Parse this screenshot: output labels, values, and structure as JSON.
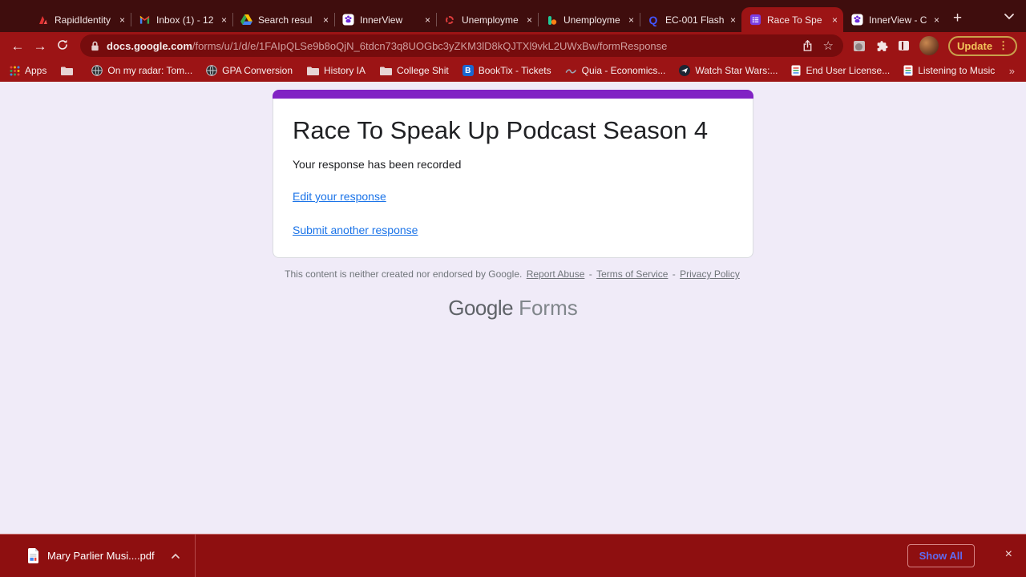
{
  "colors": {
    "tabstrip_bg": "#3f0d0d",
    "toolbar_bg": "#9c1415",
    "omnibox_bg": "#760c0d",
    "page_bg": "#f0ebf8",
    "form_purple": "#8123c4",
    "link_blue": "#1a73e8",
    "shelf_bg": "#8e0f10",
    "update_gold": "#f3c45a",
    "show_all_blue": "#5f6af0"
  },
  "browser": {
    "tabs": [
      {
        "label": "RapidIdentity",
        "icon": "rapididentity-icon",
        "active": false
      },
      {
        "label": "Inbox (1) - 12",
        "icon": "gmail-icon",
        "active": false
      },
      {
        "label": "Search resul",
        "icon": "google-drive-icon",
        "active": false
      },
      {
        "label": "InnerView",
        "icon": "innerview-icon",
        "active": false
      },
      {
        "label": "Unemployme",
        "icon": "fred-dashed-circle-icon",
        "active": false
      },
      {
        "label": "Unemployme",
        "icon": "chart-bar-dot-icon",
        "active": false
      },
      {
        "label": "EC-001 Flash",
        "icon": "quizlet-icon",
        "active": false
      },
      {
        "label": "Race To Spe",
        "icon": "google-forms-icon",
        "active": true
      },
      {
        "label": "InnerView - C",
        "icon": "innerview-icon",
        "active": false
      }
    ],
    "tab_close_icon": "×",
    "new_tab_icon": "+",
    "toolbar": {
      "back_icon": "←",
      "forward_icon": "→",
      "url_host": "docs.google.com",
      "url_path": "/forms/u/1/d/e/1FAIpQLSe9b8oQjN_6tdcn73q8UOGbc3yZKM3lD8kQJTXl9vkL2UWxBw/formResponse",
      "star_icon": "☆",
      "update_label": "Update",
      "update_menu_icon": "⋮"
    },
    "bookmarks": [
      {
        "label": "Apps",
        "icon": "apps-grid-icon"
      },
      {
        "label": "",
        "icon": "folder-icon"
      },
      {
        "label": "On my radar: Tom...",
        "icon": "globe-icon"
      },
      {
        "label": "GPA Conversion",
        "icon": "globe-icon"
      },
      {
        "label": "History IA",
        "icon": "folder-icon"
      },
      {
        "label": "College Shit",
        "icon": "folder-icon"
      },
      {
        "label": "BookTix - Tickets",
        "icon": "booktix-icon"
      },
      {
        "label": "Quia - Economics...",
        "icon": "quia-icon"
      },
      {
        "label": "Watch Star Wars:...",
        "icon": "paper-plane-circle-icon"
      },
      {
        "label": "End User License...",
        "icon": "document-icon"
      },
      {
        "label": "Listening to Music",
        "icon": "document-icon"
      }
    ],
    "bookmarks_overflow_icon": "»"
  },
  "form": {
    "title": "Race To Speak Up Podcast Season 4",
    "subtitle": "Your response has been recorded",
    "edit_link": "Edit your response",
    "submit_link": "Submit another response",
    "footer": {
      "disclaimer": "This content is neither created nor endorsed by Google.",
      "report_abuse": "Report Abuse",
      "terms": "Terms of Service",
      "privacy": "Privacy Policy",
      "separator": "-"
    },
    "logo": {
      "google": "Google",
      "forms": "Forms"
    }
  },
  "download_shelf": {
    "file_name": "Mary Parlier Musi....pdf",
    "show_all_label": "Show All",
    "close_icon": "×"
  }
}
